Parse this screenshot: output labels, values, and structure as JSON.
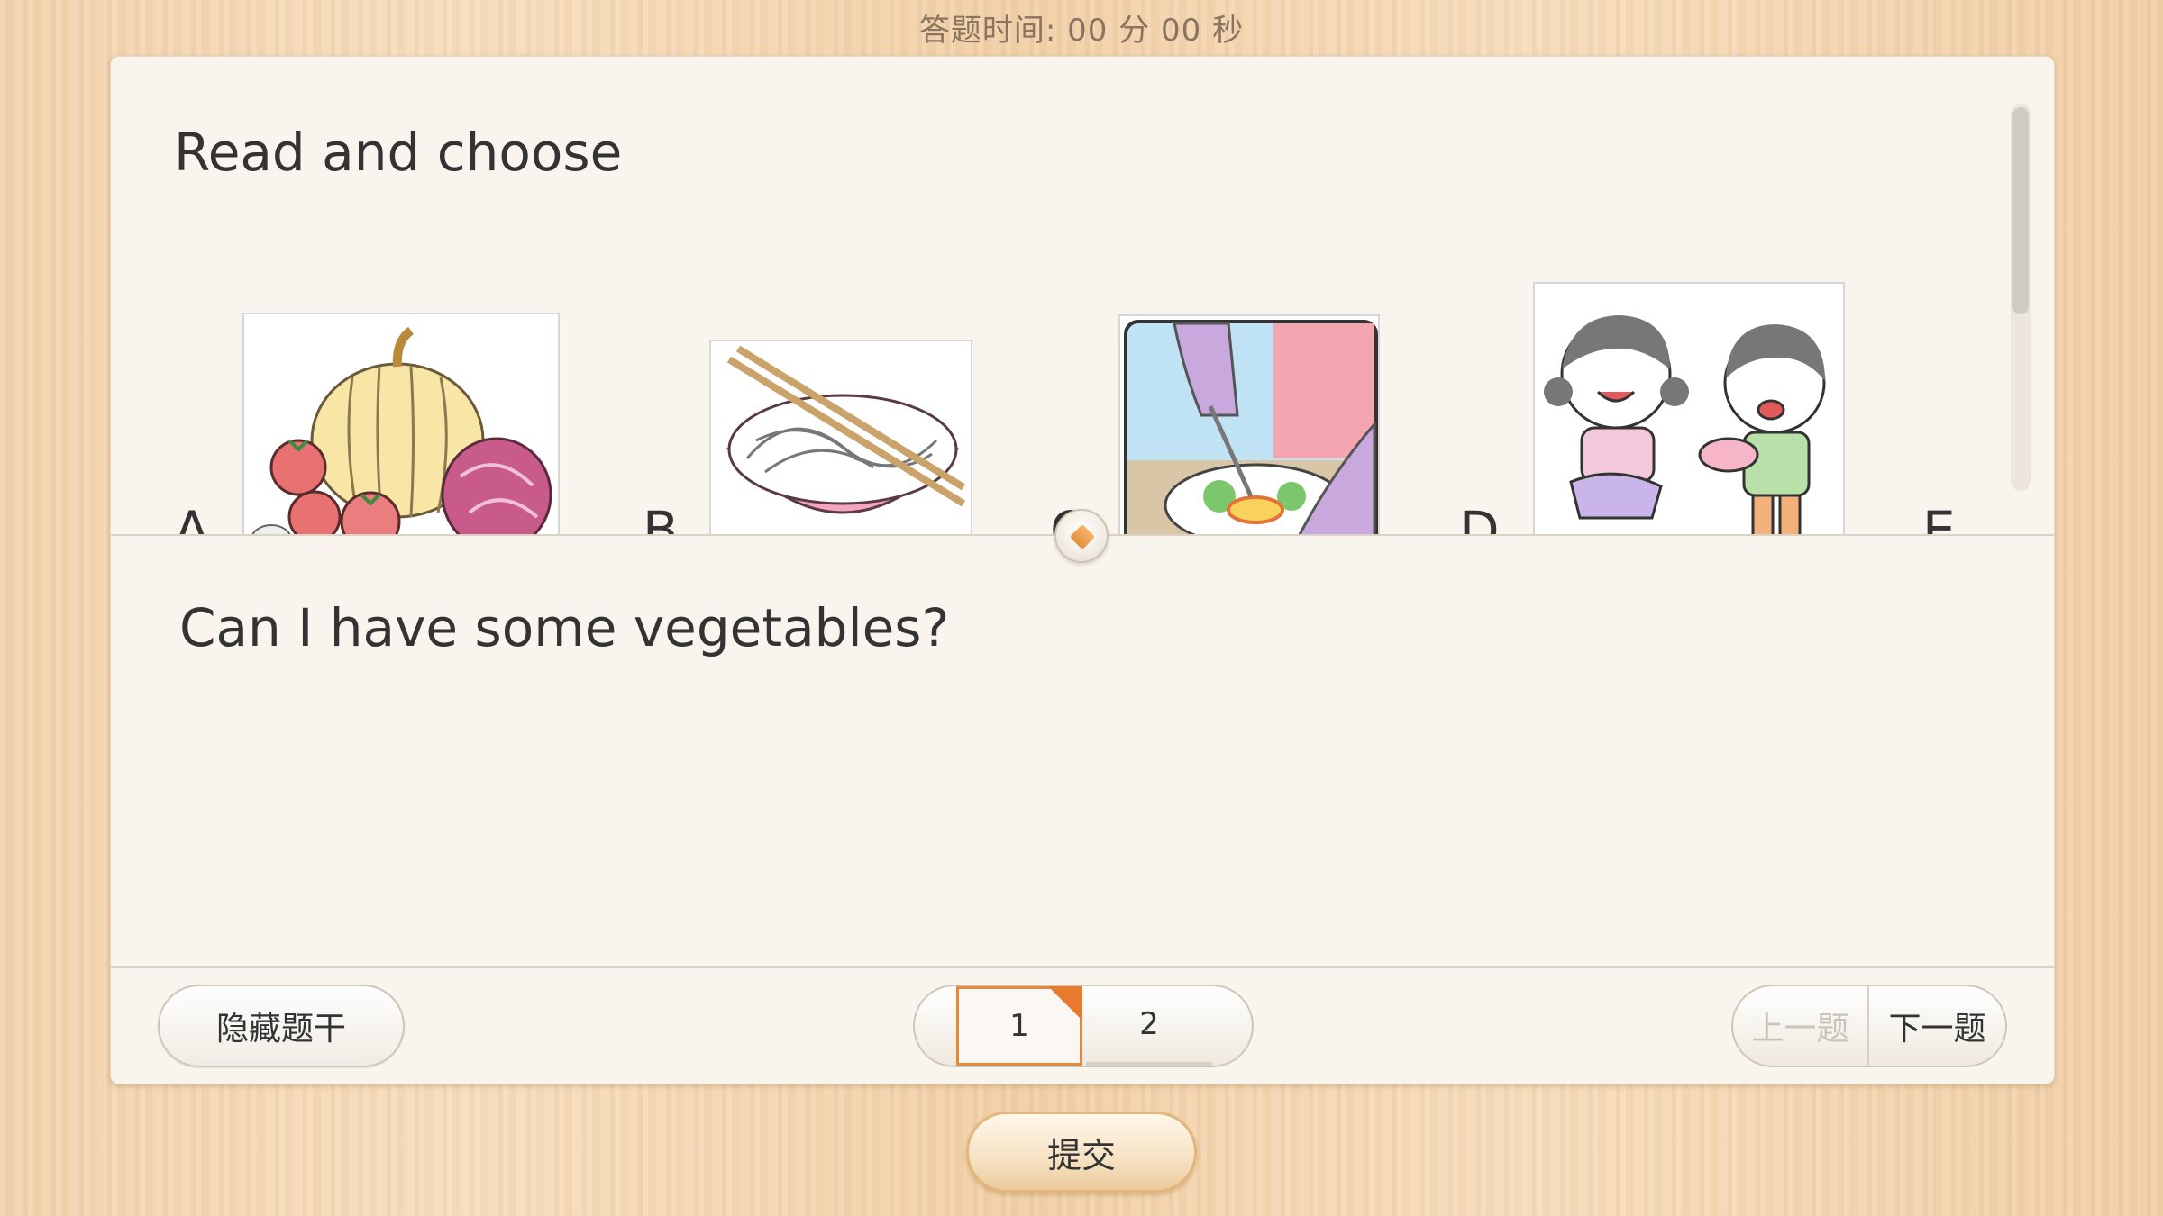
{
  "timer": {
    "label": "答题时间:",
    "value": "00 分 00 秒"
  },
  "question": {
    "instruction": "Read and choose",
    "prompt": "Can I have some vegetables?",
    "options": [
      {
        "letter": "A",
        "image": "vegetables-image"
      },
      {
        "letter": "B",
        "image": "noodles-image"
      },
      {
        "letter": "C",
        "image": "salad-fork-image"
      },
      {
        "letter": "D",
        "image": "children-bowl-image"
      },
      {
        "letter": "E"
      }
    ]
  },
  "footer": {
    "hide_label": "隐藏题干",
    "pages": [
      "1",
      "2"
    ],
    "current_page": 1,
    "prev_label": "上一题",
    "next_label": "下一题"
  },
  "submit_label": "提交",
  "colors": {
    "accent": "#e68a3a",
    "text": "#333333",
    "card": "#f9f5ee"
  }
}
